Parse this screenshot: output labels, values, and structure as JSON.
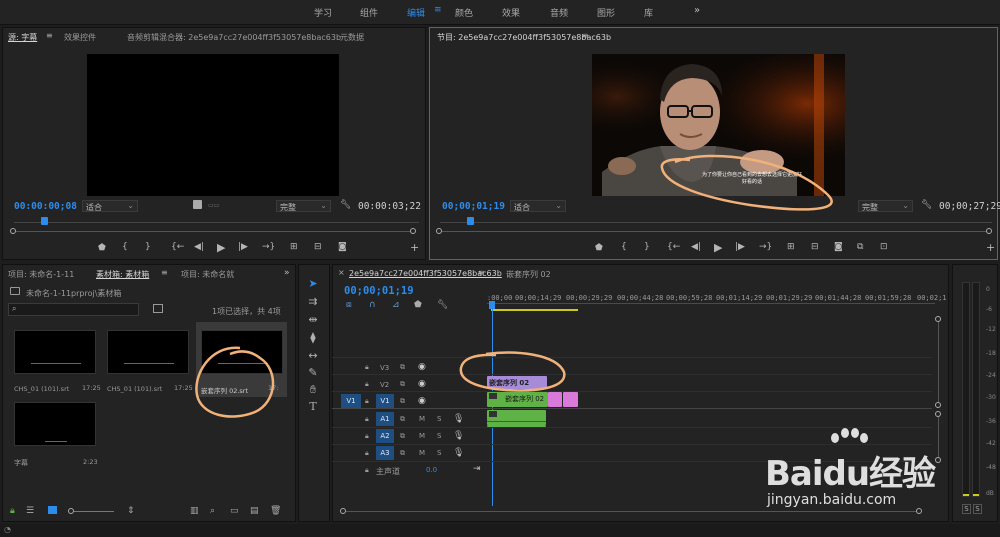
{
  "workspaces": [
    "学习",
    "组件",
    "编辑",
    "颜色",
    "效果",
    "音频",
    "图形",
    "库"
  ],
  "active_workspace": "编辑",
  "more_icon": "double-chevron-right",
  "source_panel": {
    "tabs": [
      "源: 字幕",
      "效果控件",
      "音频剪辑混合器: 2e5e9a7cc27e004ff3f53057e8bac63b",
      "元数据"
    ],
    "timecode_in": "00:00:00;08",
    "fit": "适合",
    "quality": "完整",
    "duration": "00:00:03;22"
  },
  "program_panel": {
    "tab": "节目: 2e5e9a7cc27e004ff3f53057e8bac63b",
    "timecode": "00;00;01;19",
    "fit": "适合",
    "quality": "完整",
    "duration": "00;00;27;29",
    "subtitle_line1": "为了你要让你自己看到的去想去选择它更加好",
    "subtitle_line2": "好看的话"
  },
  "project_panel": {
    "tabs": [
      "项目: 未命名-1-11",
      "素材箱: 素材箱",
      "项目: 未命名就"
    ],
    "path": "未命名-1-11prproj\\素材箱",
    "selection_info": "1项已选择，共 4项",
    "items": [
      {
        "name": "CHS_01 (101).srt",
        "duration": "17:25"
      },
      {
        "name": "CHS_01 (101).srt",
        "duration": "17:25"
      },
      {
        "name": "嵌套序列 02.srt",
        "duration": "17:"
      },
      {
        "name": "字幕",
        "duration": "2:23"
      }
    ]
  },
  "timeline": {
    "tabs": [
      "2e5e9a7cc27e004ff3f53057e8bac63b",
      "嵌套序列 02"
    ],
    "timecode": "00;00;01;19",
    "ruler": [
      ":00;00",
      "00;00;14;29",
      "00;00;29;29",
      "00;00;44;28",
      "00;00;59;28",
      "00;01;14;29",
      "00;01;29;29",
      "00;01;44;28",
      "00;01;59;28",
      "00;02;1"
    ],
    "video_tracks": [
      "V3",
      "V2",
      "V1"
    ],
    "source_patch": "V1",
    "audio_tracks": [
      "A1",
      "A2",
      "A3"
    ],
    "master_label": "主声道",
    "master_value": "0.0",
    "clip_v2_label": "嵌套序列 02",
    "clip_v1_label": "嵌套序列 02"
  },
  "audio_meter": {
    "labels": [
      "0",
      "-6",
      "-12",
      "-18",
      "-24",
      "-30",
      "-36",
      "-42",
      "-48",
      "dB"
    ],
    "solo_buttons": [
      "S",
      "S"
    ]
  },
  "watermark": {
    "brand": "Baidu经验",
    "url": "jingyan.baidu.com"
  },
  "colors": {
    "accent": "#2d8ceb",
    "v_clip": "#a68bd9",
    "nest_green": "#5fb346",
    "pink": "#d979d9",
    "annotation": "#f0b27a"
  }
}
